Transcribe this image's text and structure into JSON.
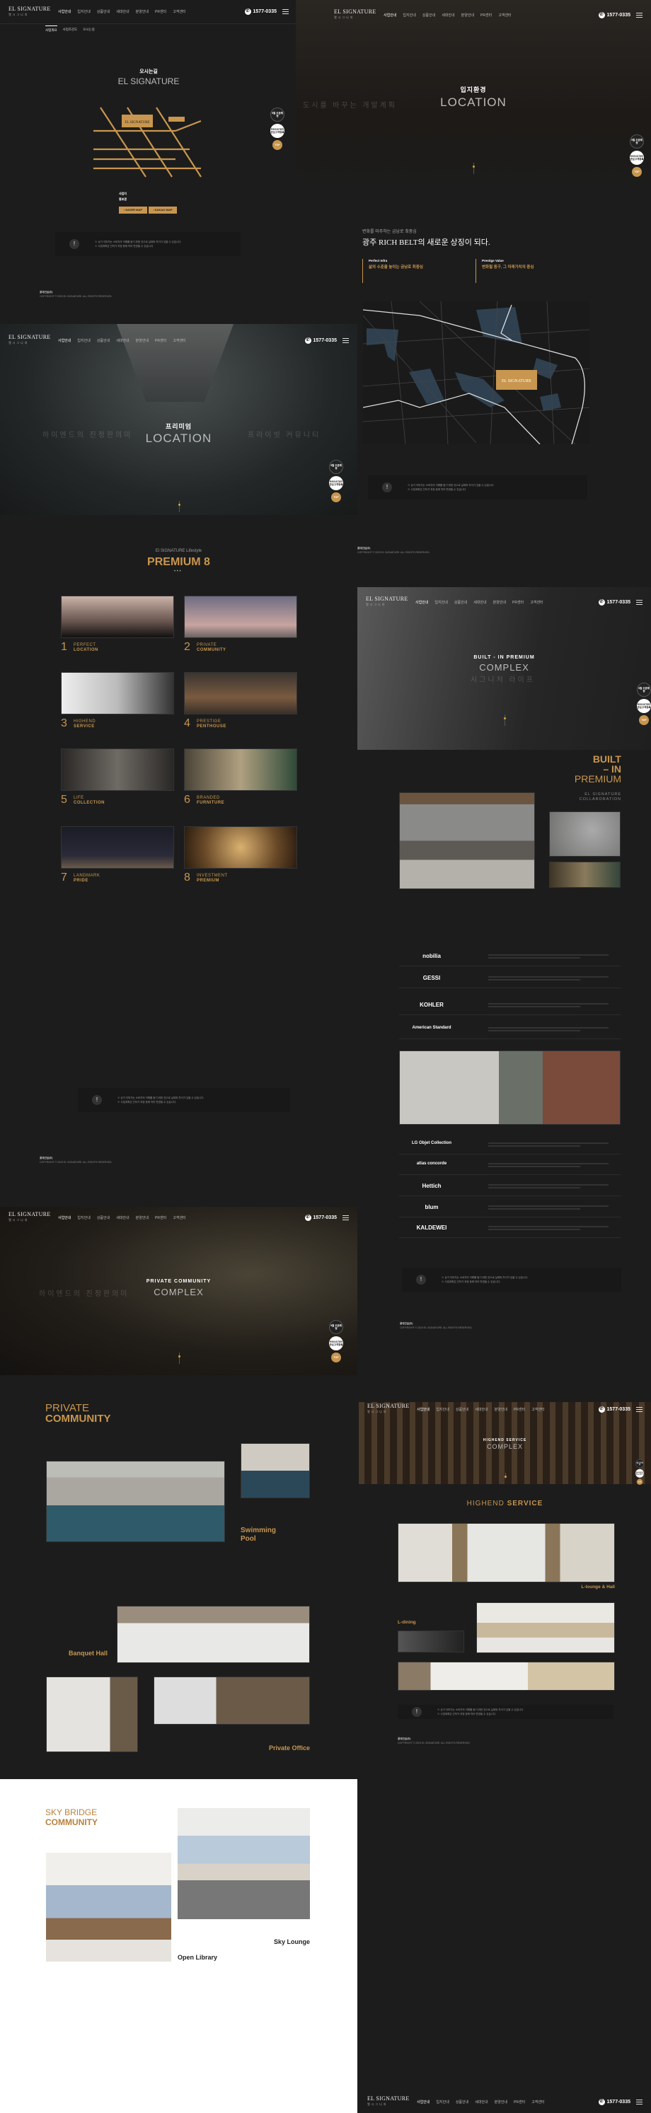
{
  "header": {
    "logo": "EL SIGNATURE",
    "logo_sub": "엘시그니처",
    "nav": [
      "사업안내",
      "입지안내",
      "상품안내",
      "세대안내",
      "분양안내",
      "PR센터",
      "고객센터"
    ],
    "phone": "1577-0335",
    "subnav": [
      "사업개요",
      "사업조감도",
      "오시는길"
    ]
  },
  "side": {
    "open": "5월 오픈예정",
    "register": "REGISTER 관심고객등록",
    "top": "TOP"
  },
  "colors": {
    "accent": "#c8964e",
    "bg": "#1c1c1c"
  },
  "directions": {
    "kr": "오시는길",
    "en": "EL SIGNATURE",
    "map_logo": "EL SIGNATURE",
    "naver": "› NAVER MAP",
    "kakao": "› KAKAO MAP",
    "addr_label_1": "사업지",
    "addr_label_2": "홍보관"
  },
  "notice": {
    "icon": "!",
    "lines": [
      "※ 상기 이미지는 소비자의 이해를 돕기 위한 것으로 실제와 차이가 있을 수 있습니다.",
      "※ 사업계획은 인허가 과정 등에 따라 변경될 수 있습니다."
    ]
  },
  "footer": {
    "builder": "롯데건설(주)",
    "copyright": "COPYRIGHT © 2023 EL SIGNATURE. ALL RIGHTS RESERVED."
  },
  "location_hero": {
    "kr": "입지환경",
    "en": "LOCATION",
    "ghost": "도시를 바꾸는 개발계획"
  },
  "location": {
    "sub": "변화를 마주하는 금남로 최중심",
    "title": "광주 RICH BELT의 새로운 상징이 되다.",
    "col1_en": "Perfect Infra",
    "col1_kr": "삶의 수준을 높이는 금남로 최중심",
    "col2_en": "Prestige Value",
    "col2_kr": "변화될 동구, 그 미래가치의 중심",
    "map_logo": "EL SIGNATURE"
  },
  "premium_hero": {
    "kr": "프리미엄",
    "en": "LOCATION",
    "ghost1": "하이엔드의 진정한의미",
    "ghost2": "프라이빗 커뮤니티"
  },
  "premium8": {
    "sub": "El SIGNATURE Lifestyle",
    "title": "PREMIUM 8",
    "items": [
      {
        "n": "1",
        "a": "PERFECT",
        "b": "LOCATION"
      },
      {
        "n": "2",
        "a": "PRIVATE",
        "b": "COMMUNITY"
      },
      {
        "n": "3",
        "a": "HIGHEND",
        "b": "SERVICE"
      },
      {
        "n": "4",
        "a": "PRESTIGE",
        "b": "PENTHOUSE"
      },
      {
        "n": "5",
        "a": "LIFE",
        "b": "COLLECTION"
      },
      {
        "n": "6",
        "a": "BRANDED",
        "b": "FURNITURE"
      },
      {
        "n": "7",
        "a": "LANDMARK",
        "b": "PRIDE"
      },
      {
        "n": "8",
        "a": "INVESTMENT",
        "b": "PREMIUM"
      }
    ]
  },
  "builtin_hero": {
    "kr": "BUILT - IN PREMIUM",
    "en": "COMPLEX",
    "ghost": "시그니처 라이프"
  },
  "builtin": {
    "t1": "BUILT",
    "t2": "– IN",
    "t3": "PREMIUM",
    "sub1": "EL SIGNATURE",
    "sub2": "COLLABORATION",
    "brands": [
      "nobilia",
      "GESSI",
      "KOHLER",
      "American Standard"
    ],
    "brands2": [
      "LG Objet Collection",
      "atlas concorde",
      "Hettich",
      "blum",
      "KALDEWEI"
    ]
  },
  "community_hero": {
    "kr": "PRIVATE COMMUNITY",
    "en": "COMPLEX",
    "ghost": "하이엔드의 진정한의미"
  },
  "community": {
    "t1": "PRIVATE",
    "t2": "COMMUNITY",
    "pool": "Swimming Pool",
    "banquet": "Banquet Hall",
    "office": "Private Office"
  },
  "skybridge": {
    "t1": "SKY BRIDGE",
    "t2": "COMMUNITY",
    "library": "Open Library",
    "lounge": "Sky Lounge"
  },
  "highend_hero": {
    "kr": "HIGHEND SERVICE",
    "en": "COMPLEX"
  },
  "highend": {
    "t1": "HIGHEND",
    "t2": "SERVICE",
    "lounge": "L-lounge & Hall",
    "dining": "L-dining"
  }
}
